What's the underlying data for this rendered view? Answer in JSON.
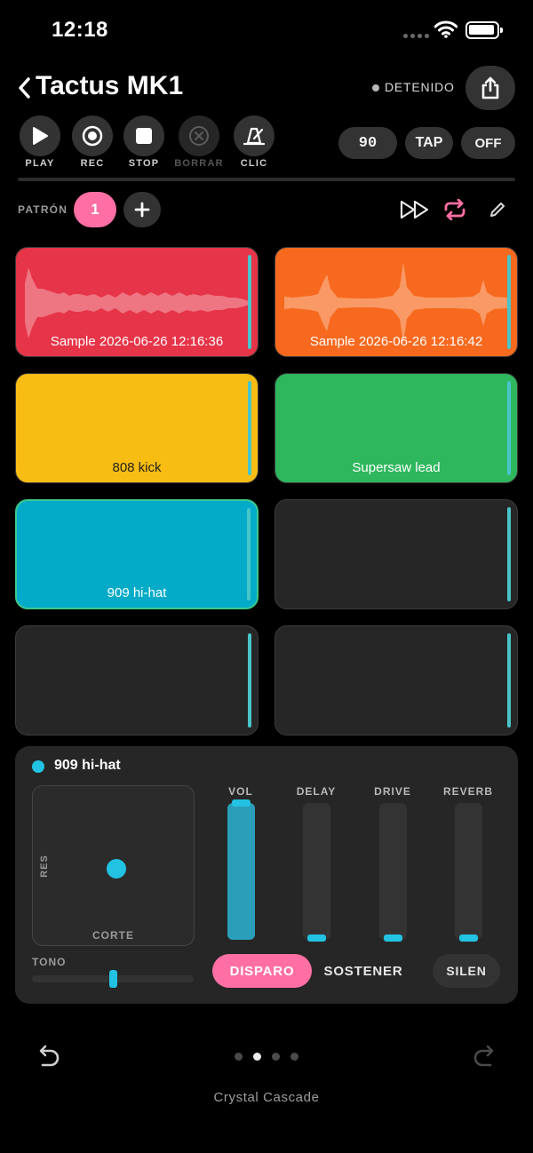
{
  "status_bar": {
    "time": "12:18"
  },
  "header": {
    "title": "Tactus MK1",
    "status": "DETENIDO"
  },
  "transport": {
    "buttons": [
      {
        "label": "PLAY",
        "icon": "play-icon"
      },
      {
        "label": "REC",
        "icon": "record-icon"
      },
      {
        "label": "STOP",
        "icon": "stop-icon"
      },
      {
        "label": "BORRAR",
        "icon": "clear-icon",
        "disabled": true
      },
      {
        "label": "CLIC",
        "icon": "metronome-icon"
      }
    ],
    "bpm": "90",
    "tap_label": "TAP",
    "quantize_label": "OFF"
  },
  "pattern": {
    "label": "PATRÓN",
    "current": "1"
  },
  "pads": [
    {
      "label": "Sample 2026-06-26 12:16:36",
      "color": "#e63448"
    },
    {
      "label": "Sample 2026-06-26 12:16:42",
      "color": "#f7691e"
    },
    {
      "label": "808 kick",
      "color": "#f8bd12"
    },
    {
      "label": "Supersaw lead",
      "color": "#2eb75d"
    },
    {
      "label": "909 hi-hat",
      "color": "#04abc9",
      "selected": true
    },
    {
      "label": "",
      "color": "#262626"
    },
    {
      "label": "",
      "color": "#262626"
    },
    {
      "label": "",
      "color": "#262626"
    }
  ],
  "panel": {
    "pad_name": "909 hi-hat",
    "accent": "#22c2e2",
    "xy": {
      "y_label": "RES",
      "x_label": "CORTE"
    },
    "tone_label": "TONO",
    "tone": 0.5,
    "faders": [
      {
        "label": "VOL",
        "value": 1.0
      },
      {
        "label": "DELAY",
        "value": 0.0
      },
      {
        "label": "DRIVE",
        "value": 0.0
      },
      {
        "label": "REVERB",
        "value": 0.0
      }
    ],
    "modes": {
      "trigger": "DISPARO",
      "hold": "SOSTENER",
      "mute": "SILEN"
    }
  },
  "footer": {
    "preset": "Crystal Cascade",
    "page_count": 4,
    "page_active": 2
  }
}
